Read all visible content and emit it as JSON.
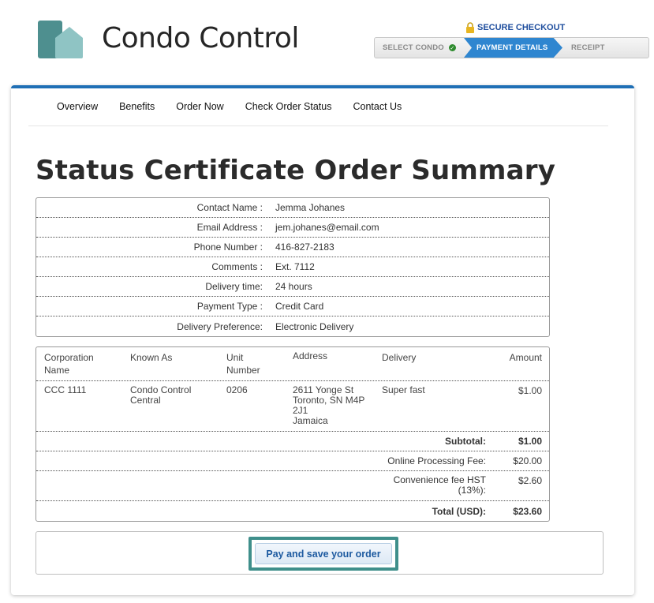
{
  "brand": {
    "name": "Condo Control",
    "colors": {
      "dark": "#4e8f8f",
      "light": "#8fc4c4"
    }
  },
  "checkout": {
    "secure_label": "SECURE CHECKOUT",
    "steps": [
      "SELECT CONDO",
      "PAYMENT DETAILS",
      "RECEIPT"
    ],
    "active_step": 1,
    "completed_icon": "check-circle-icon",
    "accent": "#2f86d0"
  },
  "nav": {
    "items": [
      "Overview",
      "Benefits",
      "Order Now",
      "Check Order Status",
      "Contact Us"
    ]
  },
  "page": {
    "title": "Status Certificate Order Summary"
  },
  "contact": {
    "rows": [
      {
        "label": "Contact Name :",
        "value": "Jemma Johanes"
      },
      {
        "label": "Email Address :",
        "value": "jem.johanes@email.com"
      },
      {
        "label": "Phone Number :",
        "value": "416-827-2183"
      },
      {
        "label": "Comments :",
        "value": "Ext. 7112"
      },
      {
        "label": "Delivery time:",
        "value": "24 hours"
      },
      {
        "label": "Payment Type :",
        "value": "Credit Card"
      },
      {
        "label": "Delivery Preference:",
        "value": "Electronic Delivery"
      }
    ]
  },
  "order": {
    "headers": {
      "corporation_1": "Corporation",
      "corporation_2": "Name",
      "known_as": "Known As",
      "unit_1": "Unit",
      "unit_2": "Number",
      "address": "Address",
      "delivery": "Delivery",
      "amount": "Amount"
    },
    "row": {
      "corporation": "CCC 1111",
      "known_as_1": "Condo Control",
      "known_as_2": "Central",
      "unit": "0206",
      "address_1": "2611 Yonge St",
      "address_2": "Toronto, SN M4P",
      "address_3": "2J1",
      "address_4": "Jamaica",
      "delivery": "Super fast",
      "amount": "$1.00"
    },
    "totals": {
      "subtotal_label": "Subtotal:",
      "subtotal": "$1.00",
      "processing_label": "Online Processing Fee:",
      "processing": "$20.00",
      "hst_label_1": "Convenience fee HST",
      "hst_label_2": "(13%):",
      "hst": "$2.60",
      "total_label": "Total (USD):",
      "total": "$23.60"
    }
  },
  "pay": {
    "button_label": "Pay and save your order"
  }
}
